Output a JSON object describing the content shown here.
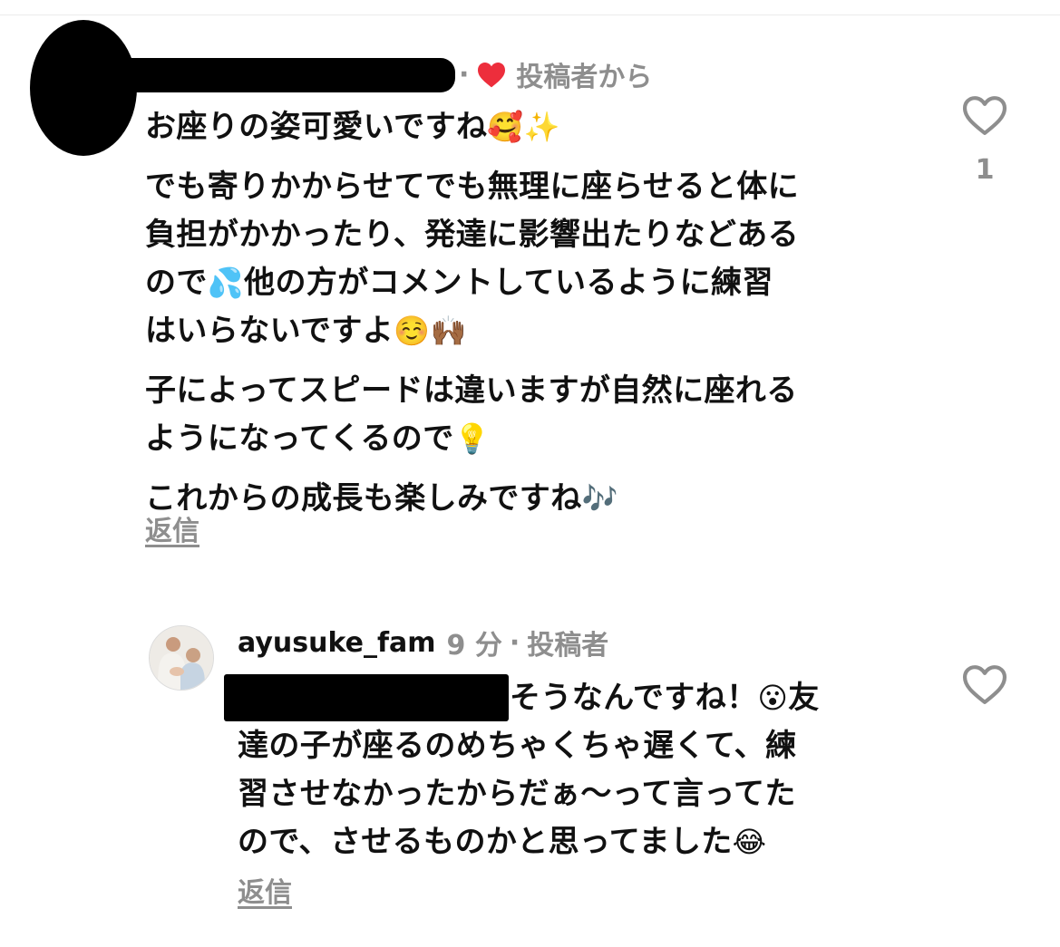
{
  "comment1": {
    "meta_separator": "·",
    "meta_label": "投稿者から",
    "lines": [
      "お座りの姿可愛いですね",
      "でも寄りかからせてでも無理に座らせると体に",
      "負担がかかったり、発達に影響出たりなどある",
      "ので",
      "他の方がコメントしているように練習",
      "はいらないですよ",
      "子によってスピードは違いますが自然に座れる",
      "ようになってくるので",
      "これからの成長も楽しみですね"
    ],
    "emojis": {
      "smiling_hearts": "🥰",
      "sparkles": "✨",
      "sweat_droplets": "💦",
      "smiling": "☺️",
      "raised_hands": "🙌🏾",
      "light_bulb": "💡",
      "notes": "🎶"
    },
    "reply_label": "返信",
    "like_count": "1"
  },
  "comment2": {
    "username": "ayusuke_fam",
    "time": "9 分",
    "separator": "·",
    "author_label": "投稿者",
    "lines": [
      "そうなんですね！",
      "友",
      "達の子が座るのめちゃくちゃ遅くて、練",
      "習させなかったからだぁ〜って言ってた",
      "ので、させるものかと思ってました"
    ],
    "emojis": {
      "surprised": "😮",
      "laughing": "😂"
    },
    "reply_label": "返信"
  },
  "colors": {
    "text": "#111111",
    "muted": "#8e8e8e",
    "heart_red": "#ed2e3c",
    "background": "#ffffff"
  },
  "icons": {
    "owner_like": "heart-filled-icon",
    "like": "heart-outline-icon"
  }
}
